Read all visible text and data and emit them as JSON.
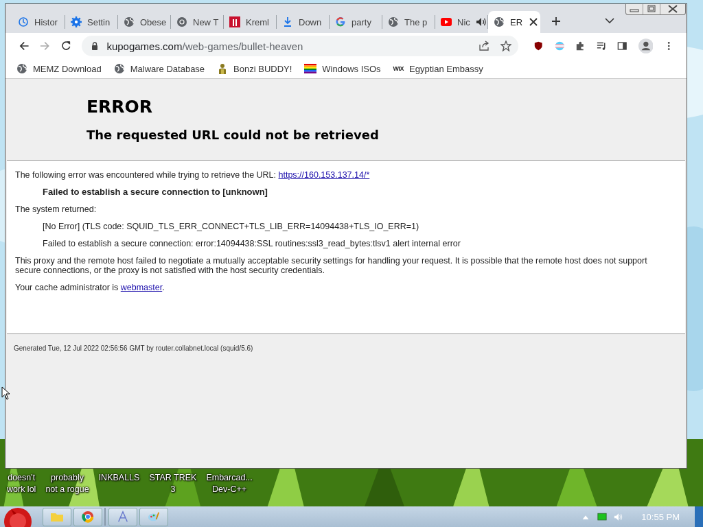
{
  "window": {
    "tabs": [
      {
        "label": "Histor",
        "kind": "history",
        "selected": false,
        "audio": false
      },
      {
        "label": "Settin",
        "kind": "gear",
        "selected": false,
        "audio": false
      },
      {
        "label": "Obese",
        "kind": "globe",
        "selected": false,
        "audio": false
      },
      {
        "label": "New T",
        "kind": "chrome",
        "selected": false,
        "audio": false
      },
      {
        "label": "Kreml",
        "kind": "tile",
        "selected": false,
        "audio": false
      },
      {
        "label": "Down",
        "kind": "download",
        "selected": false,
        "audio": false
      },
      {
        "label": "party",
        "kind": "google",
        "selected": false,
        "audio": false
      },
      {
        "label": "The p",
        "kind": "globe",
        "selected": false,
        "audio": false
      },
      {
        "label": "Nic",
        "kind": "video",
        "selected": false,
        "audio": true
      },
      {
        "label": "ER",
        "kind": "globe",
        "selected": true,
        "audio": false
      }
    ],
    "address": {
      "host": "kupogames.com",
      "path": "/web-games/bullet-heaven"
    },
    "bookmarks": [
      {
        "label": "MEMZ Download",
        "kind": "globe"
      },
      {
        "label": "Malware Database",
        "kind": "globe"
      },
      {
        "label": "Bonzi BUDDY!",
        "kind": "figure"
      },
      {
        "label": "Windows ISOs",
        "kind": "rainbow"
      },
      {
        "label": "Egyptian Embassy",
        "kind": "wordmark",
        "mark": "WIX"
      }
    ]
  },
  "page": {
    "title": "ERROR",
    "subtitle": "The requested URL could not be retrieved",
    "paragraphs": [
      {
        "kind": "text",
        "text": "The following error was encountered while trying to retrieve the URL: ",
        "link": "https://160.153.137.14/*"
      },
      {
        "kind": "strong",
        "text": "Failed to establish a secure connection to [unknown]"
      },
      {
        "kind": "text",
        "text": "The system returned:"
      },
      {
        "kind": "indent",
        "text": "[No Error] (TLS code: SQUID_TLS_ERR_CONNECT+TLS_LIB_ERR=14094438+TLS_IO_ERR=1)"
      },
      {
        "kind": "indent",
        "text": "Failed to establish a secure connection: error:14094438:SSL routines:ssl3_read_bytes:tlsv1 alert internal error"
      },
      {
        "kind": "text",
        "text": "This proxy and the remote host failed to negotiate a mutually acceptable security settings for handling your request. It is possible that the remote host does not support secure connections, or the proxy is not satisfied with the host security credentials."
      },
      {
        "kind": "text",
        "text": "Your cache administrator is ",
        "link": "webmaster",
        "after": "."
      }
    ],
    "footer": "Generated Tue, 12 Jul 2022 02:56:56 GMT by router.collabnet.local (squid/5.6)"
  },
  "desktop_icons": [
    {
      "label": "doesn't\nwork lol"
    },
    {
      "label": "probably\nnot a rogue"
    },
    {
      "label": "INKBALLS"
    },
    {
      "label": "STAR TREK\n3"
    },
    {
      "label": "Embarcad...\nDev-C++"
    }
  ],
  "taskbar": {
    "clock": "10:55 PM"
  }
}
